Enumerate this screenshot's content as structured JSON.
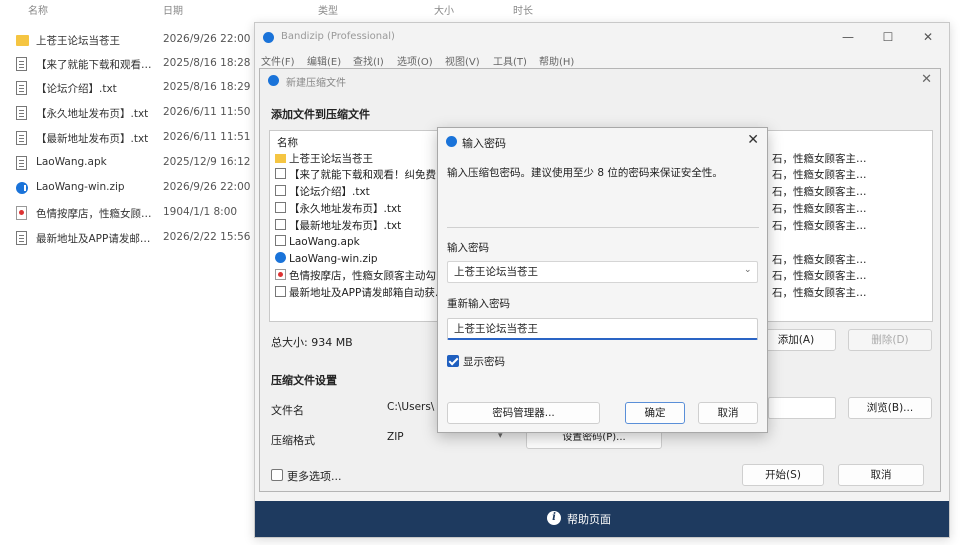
{
  "explorer": {
    "columns": [
      "名称",
      "日期",
      "类型",
      "大小",
      "时长"
    ],
    "files": [
      {
        "icon": "folder-icon",
        "name": "上苍王论坛当苍王",
        "date": "2026/9/26 22:00"
      },
      {
        "icon": "document-icon",
        "name": "【来了就能下载和观看…",
        "date": "2025/8/16 18:28"
      },
      {
        "icon": "document-icon",
        "name": "【论坛介绍】.txt",
        "date": "2025/8/16 18:29"
      },
      {
        "icon": "document-icon",
        "name": "【永久地址发布页】.txt",
        "date": "2026/6/11 11:50"
      },
      {
        "icon": "document-icon",
        "name": "【最新地址发布页】.txt",
        "date": "2026/6/11 11:51"
      },
      {
        "icon": "document-icon",
        "name": "LaoWang.apk",
        "date": "2025/12/9 16:12"
      },
      {
        "icon": "zip-icon",
        "name": "LaoWang-win.zip",
        "date": "2026/9/26 22:00"
      },
      {
        "icon": "image-icon",
        "name": "色情按摩店，性瘾女顾…",
        "date": "1904/1/1 8:00"
      },
      {
        "icon": "document-icon",
        "name": "最新地址及APP请发邮…",
        "date": "2026/2/22 15:56"
      }
    ]
  },
  "bandizip": {
    "title": "Bandizip (Professional)",
    "menu": [
      "文件(F)",
      "编辑(E)",
      "查找(I)",
      "选项(O)",
      "视图(V)",
      "工具(T)",
      "帮助(H)"
    ],
    "window_buttons": {
      "minimize": "—",
      "maximize": "☐",
      "close": "✕"
    },
    "footer_help": "帮助页面"
  },
  "new_archive": {
    "title": "新建压缩文件",
    "add_files_heading": "添加文件到压缩文件",
    "list_header": "名称",
    "list_items": [
      {
        "icon": "folder-icon",
        "name": "上苍王论坛当苍王"
      },
      {
        "icon": "document-icon",
        "name": "【来了就能下载和观看！纠免费…"
      },
      {
        "icon": "document-icon",
        "name": "【论坛介绍】.txt"
      },
      {
        "icon": "document-icon",
        "name": "【永久地址发布页】.txt"
      },
      {
        "icon": "document-icon",
        "name": "【最新地址发布页】.txt"
      },
      {
        "icon": "document-icon",
        "name": "LaoWang.apk"
      },
      {
        "icon": "zip-icon",
        "name": "LaoWang-win.zip"
      },
      {
        "icon": "image-icon",
        "name": "色情按摩店，性瘾女顾客主动勾…"
      },
      {
        "icon": "document-icon",
        "name": "最新地址及APP请发邮箱自动获…"
      }
    ],
    "right_col_items": [
      "石，性瘾女顾客主…",
      "石，性瘾女顾客主…",
      "石，性瘾女顾客主…",
      "石，性瘾女顾客主…",
      "石，性瘾女顾客主…",
      "石，性瘾女顾客主…",
      "石，性瘾女顾客主…",
      "石，性瘾女顾客主…"
    ],
    "total_size": "总大小: 934 MB",
    "add_button": "添加(A)",
    "delete_button": "删除(D)",
    "settings_heading": "压缩文件设置",
    "filename_label": "文件名",
    "filename_value": "C:\\Users\\",
    "browse_button": "浏览(B)...",
    "format_label": "压缩格式",
    "format_value": "ZIP",
    "set_password_button": "设置密码(P)...",
    "more_options": "更多选项...",
    "start_button": "开始(S)",
    "cancel_button": "取消"
  },
  "password_dialog": {
    "title": "输入密码",
    "description": "输入压缩包密码。建议使用至少 8 位的密码来保证安全性。",
    "enter_label": "输入密码",
    "enter_value": "上苍王论坛当苍王",
    "reenter_label": "重新输入密码",
    "reenter_value": "上苍王论坛当苍王",
    "show_password": "显示密码",
    "show_password_checked": true,
    "manager_button": "密码管理器...",
    "ok_button": "确定",
    "cancel_button": "取消"
  }
}
